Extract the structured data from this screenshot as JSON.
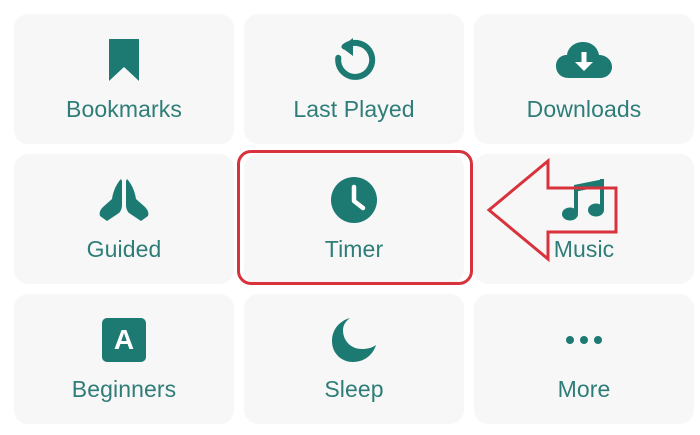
{
  "colors": {
    "accent": "#1c7a73",
    "label": "#2e7d78",
    "tile_bg": "#f7f7f7",
    "highlight": "#d8323c"
  },
  "tiles": [
    {
      "label": "Bookmarks",
      "icon": "bookmark-icon"
    },
    {
      "label": "Last Played",
      "icon": "replay-icon"
    },
    {
      "label": "Downloads",
      "icon": "cloud-download-icon"
    },
    {
      "label": "Guided",
      "icon": "praying-hands-icon"
    },
    {
      "label": "Timer",
      "icon": "clock-icon"
    },
    {
      "label": "Music",
      "icon": "music-note-icon"
    },
    {
      "label": "Beginners",
      "icon": "letter-a-icon",
      "icon_text": "A"
    },
    {
      "label": "Sleep",
      "icon": "moon-icon"
    },
    {
      "label": "More",
      "icon": "more-dots-icon"
    }
  ],
  "annotation": {
    "highlighted_tile": "Timer",
    "arrow_icon": "arrow-left-icon"
  }
}
